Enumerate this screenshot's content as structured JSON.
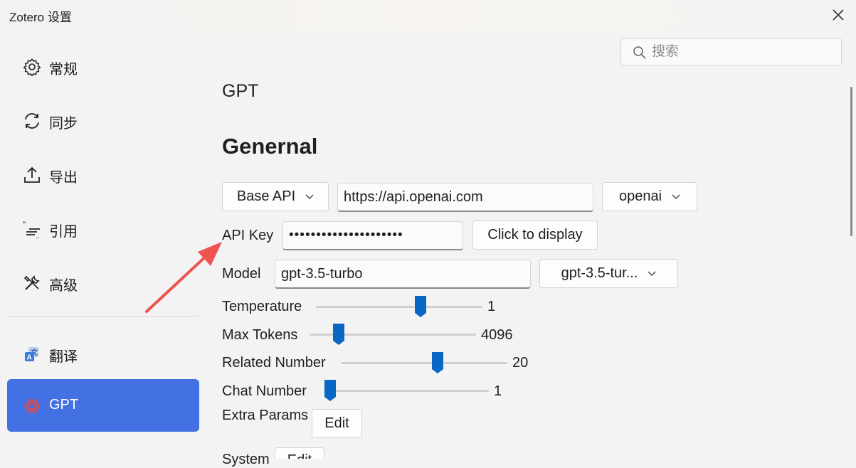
{
  "window": {
    "title": "Zotero 设置"
  },
  "sidebar": {
    "items": [
      {
        "label": "常规"
      },
      {
        "label": "同步"
      },
      {
        "label": "导出"
      },
      {
        "label": "引用"
      },
      {
        "label": "高级"
      },
      {
        "label": "翻译"
      },
      {
        "label": "GPT",
        "active": true
      }
    ]
  },
  "search": {
    "placeholder": "搜索"
  },
  "pane": {
    "title": "GPT",
    "section": "Genernal",
    "base_api": {
      "button": "Base API",
      "url": "https://api.openai.com",
      "provider": "openai"
    },
    "api_key": {
      "label": "API Key",
      "value": "•••••••••••••••••••••",
      "display_button": "Click to display"
    },
    "model": {
      "label": "Model",
      "value": "gpt-3.5-turbo",
      "select": "gpt-3.5-tur..."
    },
    "sliders": [
      {
        "label": "Temperature",
        "value": "1",
        "fraction": 0.64
      },
      {
        "label": "Max Tokens",
        "value": "4096",
        "fraction": 0.15
      },
      {
        "label": "Related Number",
        "value": "20",
        "fraction": 0.59
      },
      {
        "label": "Chat Number",
        "value": "1",
        "fraction": 0.0
      }
    ],
    "extra_params": {
      "label": "Extra Params",
      "button": "Edit"
    },
    "system": {
      "label": "System",
      "button": "Edit"
    }
  },
  "colors": {
    "accent": "#4370e3",
    "slider_thumb": "#0a67c4",
    "annotation_arrow": "#ef5350"
  }
}
